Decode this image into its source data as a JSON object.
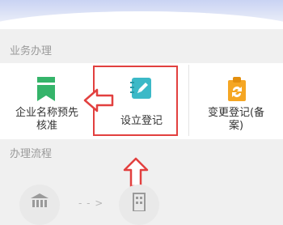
{
  "sections": {
    "services_title": "业务办理",
    "process_title": "办理流程"
  },
  "tiles": [
    {
      "label_line1": "企业名称预先",
      "label_line2": "核准",
      "icon": "bookmark-icon"
    },
    {
      "label": "设立登记",
      "icon": "notebook-edit-icon"
    },
    {
      "label_line1": "变更登记(备",
      "label_line2": "案)",
      "icon": "refresh-document-icon"
    }
  ],
  "flow": {
    "arrow": "- - >"
  },
  "colors": {
    "accent_green": "#35b46a",
    "accent_teal": "#3bb9c7",
    "accent_orange": "#f5a623",
    "annotation_red": "#e2403f"
  }
}
